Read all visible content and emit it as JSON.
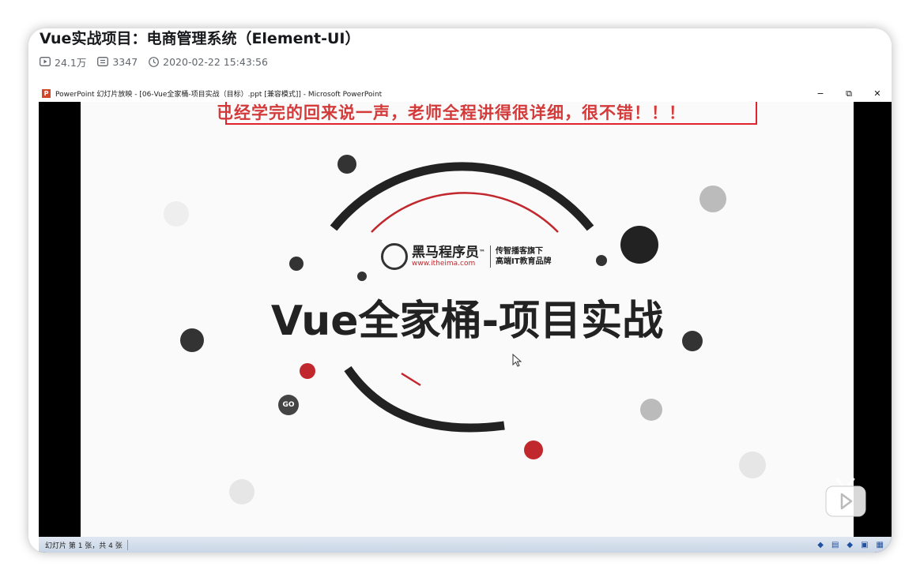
{
  "video": {
    "title": "Vue实战项目：电商管理系统（Element-UI）",
    "views": "24.1万",
    "danmaku_count": "3347",
    "publish_time": "2020-02-22 15:43:56"
  },
  "powerpoint": {
    "window_title": "PowerPoint 幻灯片放映 - [06-Vue全家桶-项目实战（目标）.ppt [兼容模式]] - Microsoft PowerPoint",
    "app_icon_letter": "P",
    "minimize": "−",
    "restore": "⧉",
    "close": "✕",
    "status_text": "幻灯片 第 1 张，共 4 张"
  },
  "slide": {
    "title": "Vue全家桶-项目实战",
    "logo_name": "黑马程序员",
    "logo_tm": "™",
    "logo_url": "www.itheima.com",
    "logo_slogan_1": "传智播客旗下",
    "logo_slogan_2": "高端IT教育品牌",
    "bubble_go": "GO"
  },
  "danmaku": {
    "text": "已经学完的回来说一声，老师全程讲得很详细，很不错！！！",
    "box_color": "#e0232f"
  },
  "colors": {
    "accent_red": "#c0282d",
    "arc_dark": "#222222"
  },
  "icons": {
    "play_count": "play-count-icon",
    "danmaku_count": "danmaku-icon",
    "clock": "clock-icon",
    "tv": "tv-icon"
  }
}
